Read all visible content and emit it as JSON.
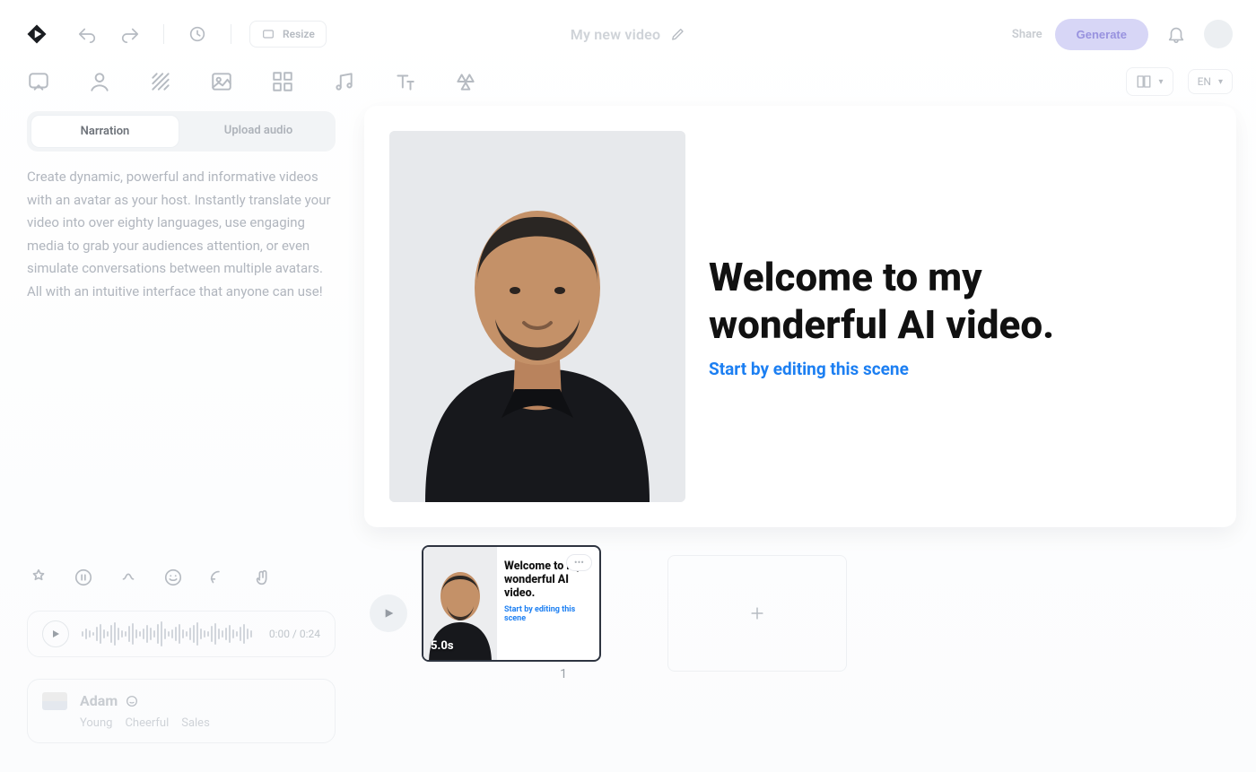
{
  "header": {
    "title": "My new video",
    "resize_chip": "Resize",
    "share_label": "Share",
    "generate_label": "Generate",
    "lang_code": "EN"
  },
  "tools": {
    "script_icon": "script-icon",
    "avatar_icon": "avatar-icon",
    "bg_icon": "background-icon",
    "media_icon": "media-icon",
    "layout_icon": "layout-grid-icon",
    "music_icon": "music-icon",
    "text_icon": "text-icon",
    "shapes_icon": "shapes-icon"
  },
  "sidebar": {
    "tabs": {
      "narration": "Narration",
      "upload": "Upload audio"
    },
    "script_text": "Create dynamic, powerful and informative videos with an avatar as your host. Instantly translate your video into over eighty languages, use engaging media to grab your audiences attention, or even simulate conversations between multiple avatars. All with an intuitive interface that anyone can use!",
    "audio_time": "0:00 / 0:24",
    "voice": {
      "name": "Adam",
      "tags": [
        "Young",
        "Cheerful",
        "Sales"
      ]
    }
  },
  "scene": {
    "headline1": "Welcome to my",
    "headline2": "wonderful AI video.",
    "subtitle": "Start by editing this scene"
  },
  "timeline": {
    "thumbs": [
      {
        "title": "Welcome to my wonderful AI video.",
        "subtitle": "Start by editing this scene",
        "duration": "5.0s",
        "index": "1"
      }
    ]
  }
}
